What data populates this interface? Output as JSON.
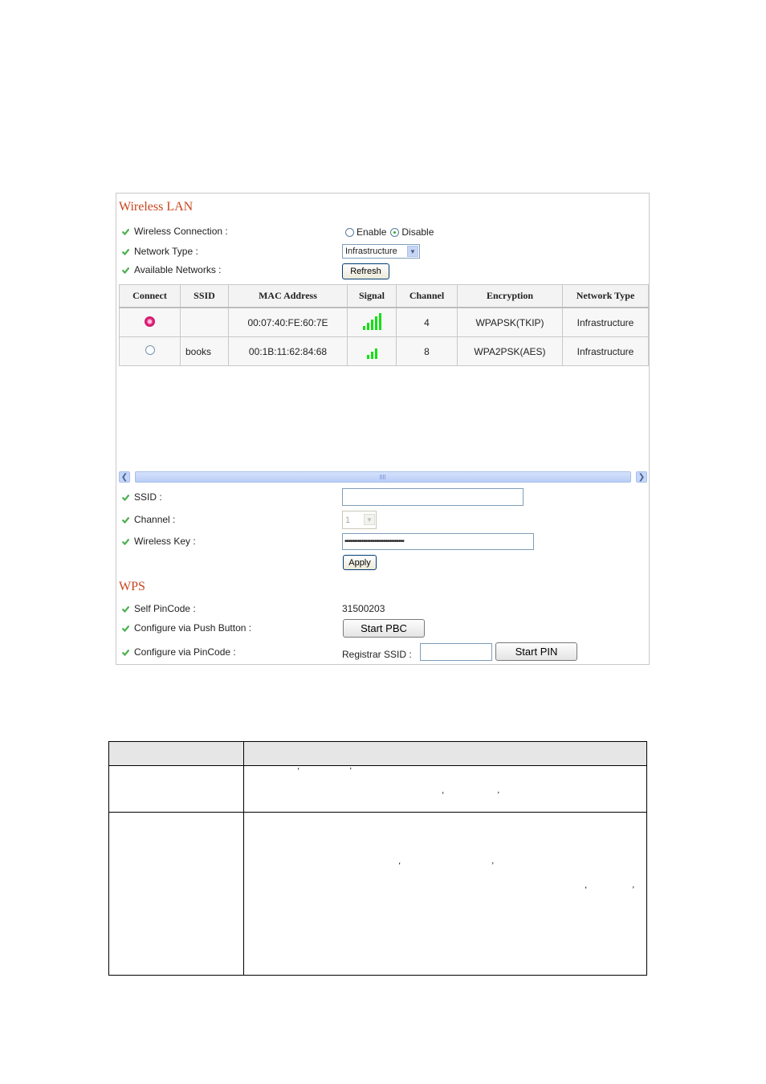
{
  "wireless_lan": {
    "title": "Wireless LAN",
    "wireless_connection": {
      "label": "Wireless Connection :",
      "options": [
        "Enable",
        "Disable"
      ],
      "selected": "Disable"
    },
    "network_type": {
      "label": "Network Type :",
      "value": "Infrastructure"
    },
    "available_networks": {
      "label": "Available Networks :",
      "refresh_label": "Refresh"
    },
    "table": {
      "headers": [
        "Connect",
        "SSID",
        "MAC Address",
        "Signal",
        "Channel",
        "Encryption",
        "Network Type"
      ],
      "rows": [
        {
          "selected": true,
          "ssid": "",
          "mac": "00:07:40:FE:60:7E",
          "signal_bars": 5,
          "channel": "4",
          "encryption": "WPAPSK(TKIP)",
          "network_type": "Infrastructure"
        },
        {
          "selected": false,
          "ssid": "books",
          "mac": "00:1B:11:62:84:68",
          "signal_bars": 3,
          "channel": "8",
          "encryption": "WPA2PSK(AES)",
          "network_type": "Infrastructure"
        }
      ]
    },
    "ssid": {
      "label": "SSID :",
      "value": ""
    },
    "channel": {
      "label": "Channel :",
      "value": "1"
    },
    "wireless_key": {
      "label": "Wireless Key :",
      "value": "••••••••••••••••••••••••••••••••"
    },
    "apply_label": "Apply"
  },
  "wps": {
    "title": "WPS",
    "self_pincode": {
      "label": "Self PinCode :",
      "value": "31500203"
    },
    "push_button": {
      "label": "Configure via Push Button :",
      "button": "Start PBC"
    },
    "pincode": {
      "label": "Configure via PinCode :",
      "registrar_label": "Registrar SSID :",
      "registrar_value": "",
      "button": "Start PIN"
    }
  },
  "description_table": {
    "quote_open": "‘",
    "quote_close": "’"
  },
  "colors": {
    "section_title": "#c8441c",
    "signal_green": "#12e012",
    "check_green": "#4caf50"
  }
}
